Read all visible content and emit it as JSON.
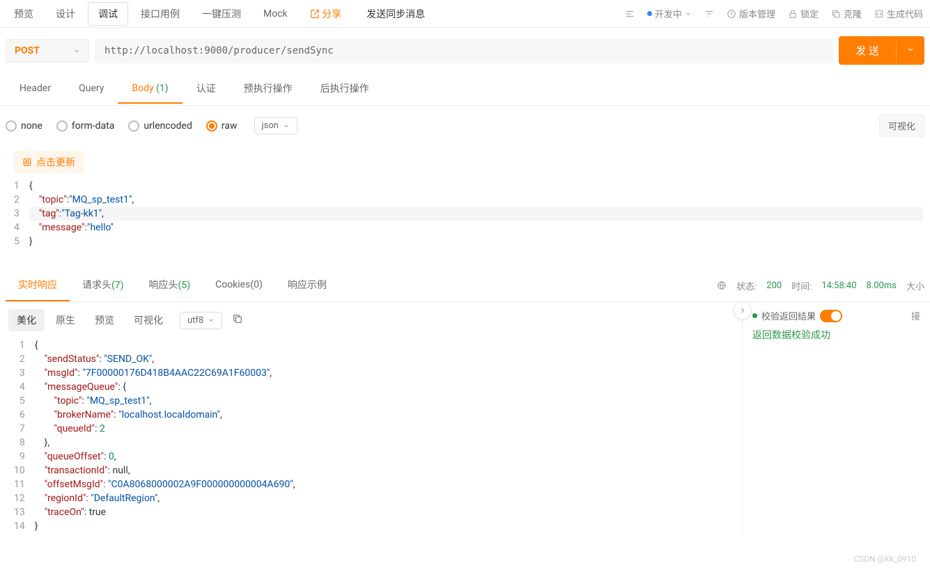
{
  "topTabs": {
    "preview": "预览",
    "design": "设计",
    "debug": "调试",
    "apiCase": "接口用例",
    "pressure": "一键压测",
    "mock": "Mock",
    "share": "分享",
    "title": "发送同步消息"
  },
  "topRight": {
    "status": "开发中",
    "version": "版本管理",
    "lock": "锁定",
    "clone": "克隆",
    "gen": "生成代码"
  },
  "request": {
    "method": "POST",
    "url": "http://localhost:9000/producer/sendSync",
    "send": "发 送"
  },
  "reqTabs": {
    "header": "Header",
    "query": "Query",
    "body": "Body",
    "bodyCount": "(1)",
    "auth": "认证",
    "preExec": "预执行操作",
    "postExec": "后执行操作"
  },
  "bodyType": {
    "none": "none",
    "formData": "form-data",
    "urlencoded": "urlencoded",
    "raw": "raw",
    "format": "json",
    "visualize": "可视化"
  },
  "refresh": "点击更新",
  "reqBody": {
    "l1": "{",
    "l2_key": "\"topic\"",
    "l2_val": "\"MQ_sp_test1\"",
    "l3_key": "\"tag\"",
    "l3_val": "\"Tag-kk1\"",
    "l4_key": "\"message\"",
    "l4_val": "\"hello\"",
    "l5": "}"
  },
  "respTabs": {
    "realtime": "实时响应",
    "reqHeaders": "请求头",
    "reqHeadersCount": "(7)",
    "respHeaders": "响应头",
    "respHeadersCount": "(5)",
    "cookies": "Cookies",
    "cookiesCount": "(0)",
    "example": "响应示例"
  },
  "respStatus": {
    "statusLabel": "状态:",
    "status": "200",
    "timeLabel": "时间:",
    "time": "14:58:40",
    "duration": "8.00ms",
    "size": "大小"
  },
  "respToolbar": {
    "beautify": "美化",
    "raw": "原生",
    "preview": "预览",
    "visualize": "可视化",
    "encoding": "utf8"
  },
  "validation": {
    "label": "校验返回结果",
    "ext": "接",
    "msg": "返回数据校验成功"
  },
  "respBody": {
    "k_sendStatus": "\"sendStatus\"",
    "v_sendStatus": "\"SEND_OK\"",
    "k_msgId": "\"msgId\"",
    "v_msgId": "\"7F00000176D418B4AAC22C69A1F60003\"",
    "k_messageQueue": "\"messageQueue\"",
    "k_topic": "\"topic\"",
    "v_topic": "\"MQ_sp_test1\"",
    "k_brokerName": "\"brokerName\"",
    "v_brokerName": "\"localhost.localdomain\"",
    "k_queueId": "\"queueId\"",
    "v_queueId": "2",
    "k_queueOffset": "\"queueOffset\"",
    "v_queueOffset": "0",
    "k_transactionId": "\"transactionId\"",
    "v_transactionId": "null",
    "k_offsetMsgId": "\"offsetMsgId\"",
    "v_offsetMsgId": "\"C0A8068000002A9F000000000004A690\"",
    "k_regionId": "\"regionId\"",
    "v_regionId": "\"DefaultRegion\"",
    "k_traceOn": "\"traceOn\"",
    "v_traceOn": "true"
  },
  "watermark": "CSDN @kk_0910"
}
